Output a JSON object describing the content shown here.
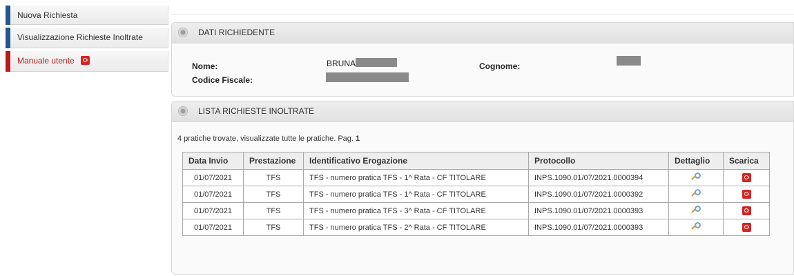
{
  "sidebar": {
    "items": [
      {
        "label": "Nuova Richiesta"
      },
      {
        "label": "Visualizzazione Richieste Inoltrate"
      },
      {
        "label": "Manuale utente",
        "icon": "pdf-icon"
      }
    ]
  },
  "richiedente": {
    "title": "DATI RICHIEDENTE",
    "nome_label": "Nome:",
    "nome_value": "BRUNA",
    "cognome_label": "Cognome:",
    "codice_fiscale_label": "Codice Fiscale:"
  },
  "lista": {
    "title": "LISTA RICHIESTE INOLTRATE",
    "summary_text": "4 pratiche trovate, visualizzate tutte le pratiche. Pag.",
    "page": "1",
    "columns": [
      "Data Invio",
      "Prestazione",
      "Identificativo Erogazione",
      "Protocollo",
      "Dettaglio",
      "Scarica"
    ],
    "rows": [
      {
        "data": "01/07/2021",
        "prestazione": "TFS",
        "identificativo": "TFS - numero pratica TFS - 1^ Rata - CF TITOLARE",
        "protocollo": "INPS.1090.01/07/2021.0000394"
      },
      {
        "data": "01/07/2021",
        "prestazione": "TFS",
        "identificativo": "TFS - numero pratica TFS - 1^ Rata - CF TITOLARE",
        "protocollo": "INPS.1090.01/07/2021.0000392"
      },
      {
        "data": "01/07/2021",
        "prestazione": "TFS",
        "identificativo": "TFS - numero pratica TFS - 3^ Rata - CF TITOLARE",
        "protocollo": "INPS.1090.01/07/2021.0000393"
      },
      {
        "data": "01/07/2021",
        "prestazione": "TFS",
        "identificativo": "TFS - numero pratica TFS - 2^ Rata - CF TITOLARE",
        "protocollo": "INPS.1090.01/07/2021.0000393"
      }
    ]
  },
  "colors": {
    "nav_blue": "#23578e",
    "nav_red": "#b71c1c",
    "pdf_red": "#d32424"
  }
}
